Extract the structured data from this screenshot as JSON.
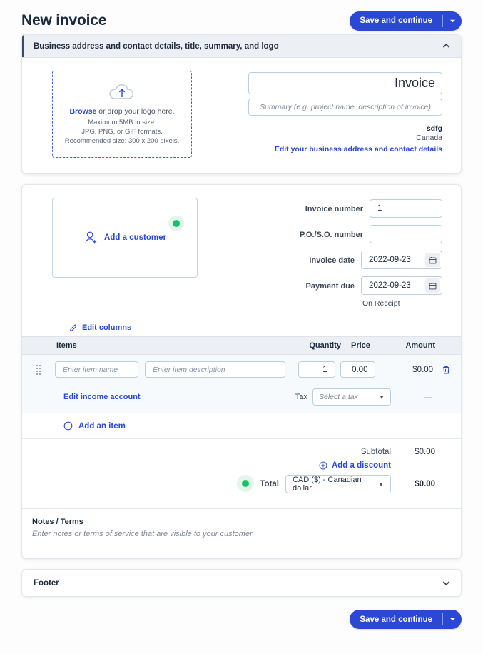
{
  "header": {
    "title": "New invoice",
    "save_label": "Save and continue"
  },
  "business_section": {
    "title": "Business address and contact details, title, summary, and logo",
    "dropzone": {
      "browse_label": "Browse",
      "drop_text": " or drop your logo here.",
      "max_size": "Maximum 5MB in size.",
      "formats": "JPG, PNG, or GIF formats.",
      "recommended": "Recommended size: 300 x 200 pixels."
    },
    "invoice_title_value": "Invoice",
    "summary_placeholder": "Summary (e.g. project name, description of invoice)",
    "business_name": "sdfg",
    "business_country": "Canada",
    "edit_business_link": "Edit your business address and contact details"
  },
  "invoice_section": {
    "add_customer_label": "Add a customer",
    "fields": [
      {
        "label": "Invoice number",
        "value": "1",
        "placeholder": ""
      },
      {
        "label": "P.O./S.O. number",
        "value": "",
        "placeholder": ""
      },
      {
        "label": "Invoice date",
        "value": "2022-09-23",
        "placeholder": ""
      },
      {
        "label": "Payment due",
        "value": "2022-09-23",
        "placeholder": ""
      }
    ],
    "payment_terms": "On Receipt"
  },
  "items_table": {
    "edit_columns_label": "Edit columns",
    "columns": {
      "items": "Items",
      "quantity": "Quantity",
      "price": "Price",
      "amount": "Amount"
    },
    "rows": [
      {
        "name_placeholder": "Enter item name",
        "description_placeholder": "Enter item description",
        "quantity": "1",
        "price": "0.00",
        "amount": "$0.00"
      }
    ],
    "edit_income_account": "Edit income account",
    "tax_label": "Tax",
    "tax_placeholder": "Select a tax",
    "tax_amount": "—",
    "add_item_label": "Add an item"
  },
  "totals": {
    "subtotal_label": "Subtotal",
    "subtotal_value": "$0.00",
    "add_discount_label": "Add a discount",
    "total_label": "Total",
    "currency_value": "CAD ($) - Canadian dollar",
    "total_value": "$0.00"
  },
  "notes": {
    "title": "Notes / Terms",
    "placeholder": "Enter notes or terms of service that are visible to your customer"
  },
  "footer_section": {
    "title": "Footer"
  },
  "bottom": {
    "save_label": "Save and continue"
  },
  "colors": {
    "brand_blue": "#2b48d4",
    "link_blue": "#2b48d4",
    "green_status": "#17c264",
    "header_band": "#eceff3",
    "row_tint": "#f7fafd"
  }
}
